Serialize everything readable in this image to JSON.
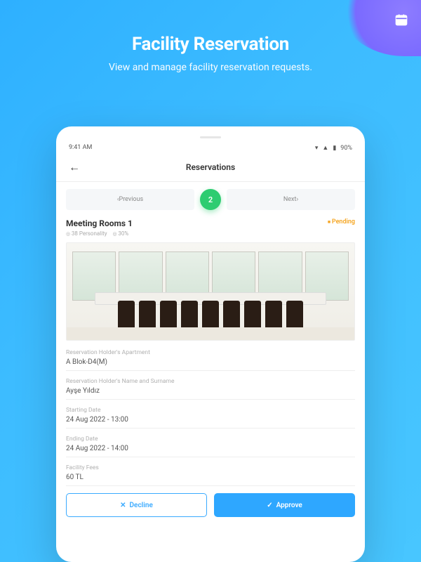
{
  "hero": {
    "title": "Facility Reservation",
    "subtitle": "View and manage facility reservation requests."
  },
  "statusbar": {
    "time": "9:41 AM",
    "battery": "90%"
  },
  "screen": {
    "title": "Reservations",
    "prev": "Previous",
    "next": "Next",
    "badge": "2"
  },
  "room": {
    "name": "Meeting Rooms 1",
    "capacity": "38 Personality",
    "occupancy": "30%",
    "status": "Pending"
  },
  "fields": {
    "apartment_label": "Reservation Holder's Apartment",
    "apartment_value": "A Blok-D4(M)",
    "name_label": "Reservation Holder's Name and Surname",
    "name_value": "Ayşe Yıldız",
    "start_label": "Starting Date",
    "start_value": "24 Aug 2022 - 13:00",
    "end_label": "Ending Date",
    "end_value": "24 Aug 2022 - 14:00",
    "fee_label": "Facility Fees",
    "fee_value": "60 TL"
  },
  "actions": {
    "decline": "Decline",
    "approve": "Approve"
  }
}
